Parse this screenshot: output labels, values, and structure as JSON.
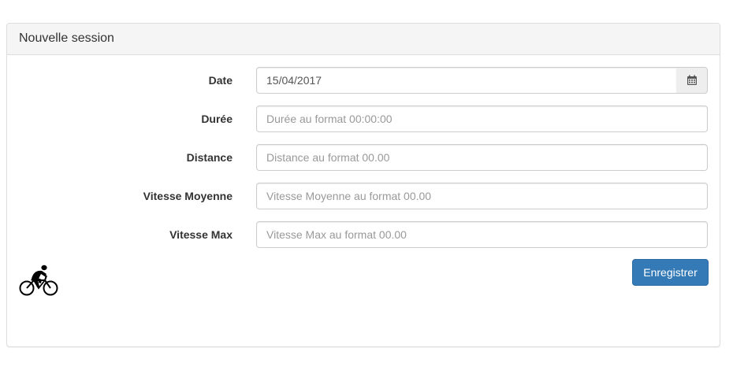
{
  "panel": {
    "title": "Nouvelle session"
  },
  "form": {
    "date": {
      "label": "Date",
      "value": "15/04/2017",
      "icon": "calendar-icon"
    },
    "duree": {
      "label": "Durée",
      "placeholder": "Durée au format 00:00:00"
    },
    "distance": {
      "label": "Distance",
      "placeholder": "Distance au format 00.00"
    },
    "vitesse_moyenne": {
      "label": "Vitesse Moyenne",
      "placeholder": "Vitesse Moyenne au format 00.00"
    },
    "vitesse_max": {
      "label": "Vitesse Max",
      "placeholder": "Vitesse Max au format 00.00"
    },
    "submit_label": "Enregistrer"
  },
  "decor": {
    "icon": "cyclist-icon"
  },
  "colors": {
    "primary": "#337ab7",
    "heading_bg": "#f5f5f5",
    "border": "#dddddd"
  }
}
